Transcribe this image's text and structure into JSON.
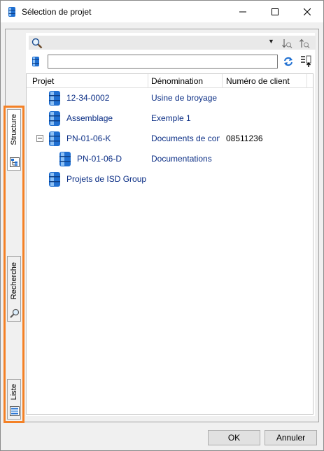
{
  "window": {
    "title": "Sélection de projet",
    "icon": "project-database-icon",
    "controls": {
      "minimize": "minimize-icon",
      "maximize": "maximize-icon",
      "close": "close-icon"
    }
  },
  "toolbar": {
    "search_icon": "magnifier-icon",
    "filter_value": "",
    "sort_desc_icon": "sort-descending-icon",
    "sort_asc_icon": "sort-ascending-icon",
    "refresh_icon": "refresh-icon",
    "columns_icon": "column-chooser-icon"
  },
  "side_tabs": [
    {
      "label": "Structure",
      "active": true,
      "icon": "tree-structure-icon"
    },
    {
      "label": "Recherche",
      "active": false,
      "icon": "search-icon"
    },
    {
      "label": "Liste",
      "active": false,
      "icon": "list-icon"
    }
  ],
  "grid": {
    "columns": [
      "Projet",
      "Dénomination",
      "Numéro de client"
    ],
    "rows": [
      {
        "projet": "12-34-0002",
        "denomination": "Usine de broyage",
        "client": "",
        "level": 0,
        "expander": false
      },
      {
        "projet": "Assemblage",
        "denomination": "Exemple 1",
        "client": "",
        "level": 0,
        "expander": false
      },
      {
        "projet": "PN-01-06-K",
        "denomination": "Documents de constr",
        "client": "08511236",
        "level": 0,
        "expander": true
      },
      {
        "projet": "PN-01-06-D",
        "denomination": "Documentations",
        "client": "",
        "level": 1,
        "expander": false
      },
      {
        "projet": "Projets de ISD Group",
        "denomination": "",
        "client": "",
        "level": 0,
        "expander": false
      }
    ]
  },
  "footer": {
    "ok_label": "OK",
    "cancel_label": "Annuler"
  },
  "colors": {
    "accent_highlight": "#f48126",
    "tree_text": "#0b2e85",
    "project_icon": "#1f6fd1"
  }
}
